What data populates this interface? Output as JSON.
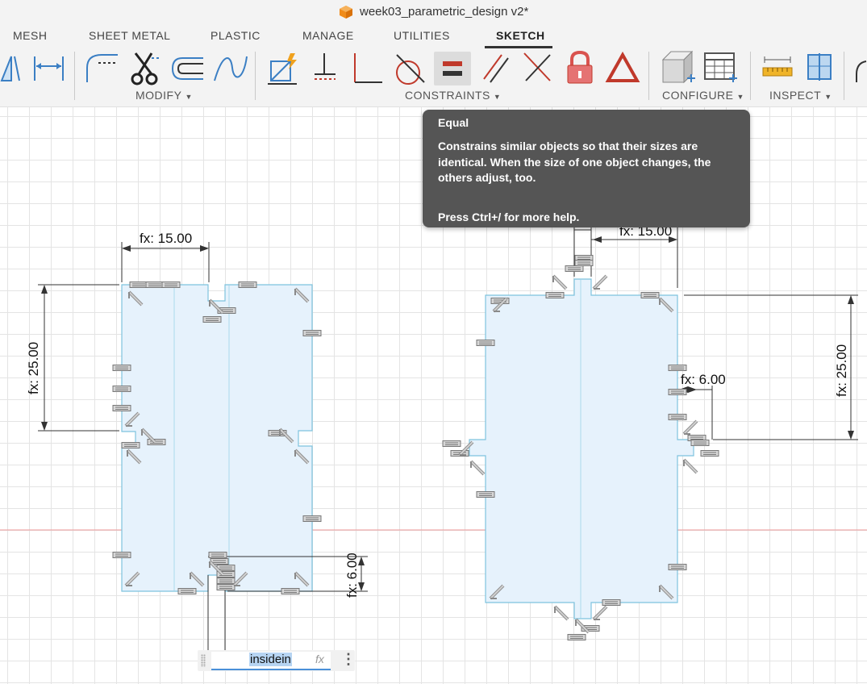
{
  "window": {
    "title": "week03_parametric_design v2*"
  },
  "tabs": [
    {
      "label": "MESH",
      "active": false
    },
    {
      "label": "SHEET METAL",
      "active": false
    },
    {
      "label": "PLASTIC",
      "active": false
    },
    {
      "label": "MANAGE",
      "active": false
    },
    {
      "label": "UTILITIES",
      "active": false
    },
    {
      "label": "SKETCH",
      "active": true
    }
  ],
  "toolbar": {
    "groups": [
      {
        "label": "MODIFY",
        "tools": [
          "offset-icon",
          "fillet-icon",
          "trim-icon",
          "extend-icon",
          "spline-icon"
        ]
      },
      {
        "label": "CONSTRAINTS",
        "tools": [
          "fix-icon",
          "coincident-icon",
          "perpendicular-icon",
          "tangent-icon",
          "equal-icon",
          "parallel-icon",
          "collinear-icon",
          "lock-icon",
          "triangle-icon"
        ]
      },
      {
        "label": "CONFIGURE",
        "tools": [
          "box-icon",
          "table-icon"
        ]
      },
      {
        "label": "INSPECT",
        "tools": [
          "measure-icon",
          "interference-icon"
        ]
      }
    ],
    "left_tools": [
      "mirror-icon",
      "dimension-icon"
    ],
    "accent": "#4a90d9"
  },
  "tooltip": {
    "title": "Equal",
    "body": "Constrains similar objects so that their sizes are identical. When the size of one object changes, the others adjust, too.",
    "help": "Press Ctrl+/ for more help."
  },
  "dimensions": {
    "left_width": "fx: 15.00",
    "left_height": "fx: 25.00",
    "left_slot": "fx: 6.00",
    "right_width": "fx: 15.00",
    "right_height": "fx: 25.00",
    "right_slot": "fx: 6.00"
  },
  "dimension_input": {
    "value": "insidein",
    "fx_label": "fx",
    "more": "⋮"
  }
}
